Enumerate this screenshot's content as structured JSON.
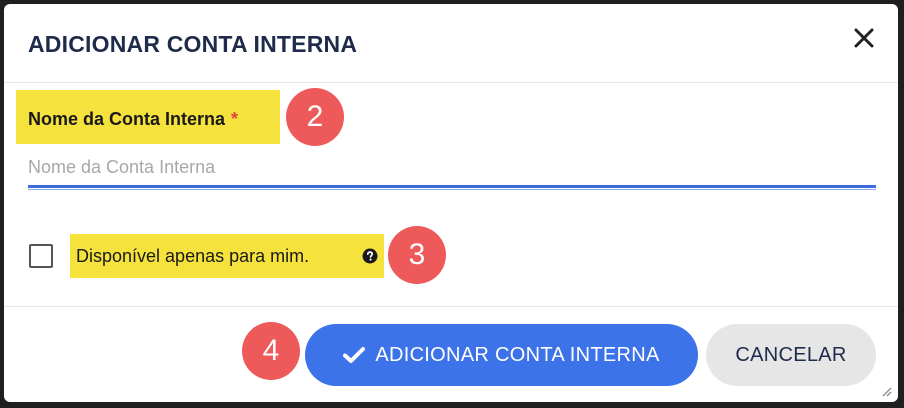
{
  "dialog": {
    "title": "ADICIONAR CONTA INTERNA",
    "close_icon": "close-icon"
  },
  "form": {
    "name_label": "Nome da Conta Interna",
    "required_mark": "*",
    "name_placeholder": "Nome da Conta Interna",
    "name_value": "",
    "checkbox_label": "Disponível apenas para mim.",
    "checkbox_checked": false,
    "help_icon": "question-circle-icon"
  },
  "annotations": {
    "step2": "2",
    "step3": "3",
    "step4": "4",
    "color": "#ee5a5a"
  },
  "footer": {
    "add_label": "ADICIONAR CONTA INTERNA",
    "add_icon": "check-icon",
    "cancel_label": "CANCELAR"
  },
  "colors": {
    "primary": "#3c73e9",
    "highlight": "#f6e23c",
    "title": "#1e2b4a",
    "required": "#e0463f"
  }
}
